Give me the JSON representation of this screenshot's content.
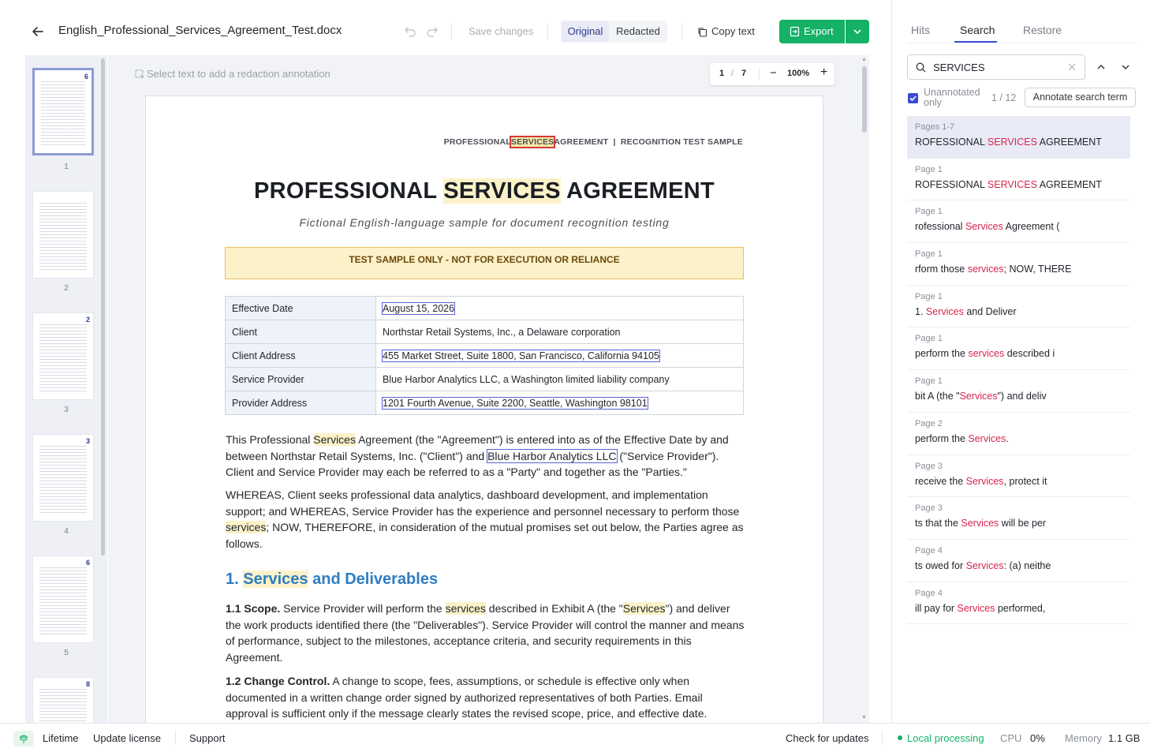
{
  "header": {
    "doc_title": "English_Professional_Services_Agreement_Test.docx",
    "save_label": "Save changes",
    "view_original": "Original",
    "view_redacted": "Redacted",
    "copy_label": "Copy text",
    "export_label": "Export"
  },
  "thumbnails": [
    {
      "badge": "6",
      "label": "1"
    },
    {
      "badge": "",
      "label": "2"
    },
    {
      "badge": "2",
      "label": "3"
    },
    {
      "badge": "3",
      "label": "4"
    },
    {
      "badge": "6",
      "label": "5"
    },
    {
      "badge": "8",
      "label": ""
    }
  ],
  "viewer": {
    "hint": "Select text to add a redaction annotation",
    "page_current": "1",
    "page_sep": "/",
    "page_total": "7",
    "zoom_minus": "−",
    "zoom": "100%",
    "zoom_plus": "+"
  },
  "document": {
    "running_head_pre": "PROFESSIONAL",
    "running_head_match": "SERVICES",
    "running_head_post": "AGREEMENT  |  RECOGNITION TEST SAMPLE",
    "title_pre": "PROFESSIONAL ",
    "title_match": "SERVICES",
    "title_post": " AGREEMENT",
    "subtitle": "Fictional English-language sample for document recognition testing",
    "banner": "TEST SAMPLE ONLY - NOT FOR EXECUTION OR RELIANCE",
    "table": [
      {
        "key": "Effective Date",
        "value": "August 15, 2026"
      },
      {
        "key": "Client",
        "value": "Northstar Retail Systems, Inc., a Delaware corporation"
      },
      {
        "key": "Client Address",
        "value": "455 Market Street, Suite 1800, San Francisco, California 94105"
      },
      {
        "key": "Service Provider",
        "value": "Blue Harbor Analytics LLC, a Washington limited liability company"
      },
      {
        "key": "Provider Address",
        "value": "1201 Fourth Avenue, Suite 2200, Seattle, Washington 98101"
      }
    ],
    "p1_a": "This Professional ",
    "p1_m": "Services",
    "p1_b": " Agreement (the \"Agreement\") is entered into as of the Effective Date by and between Northstar Retail Systems, Inc. (\"Client\") and ",
    "p1_box": "Blue Harbor Analytics LLC",
    "p1_c": " (\"Service Provider\"). Client and Service Provider may each be referred to as a \"Party\" and together as the \"Parties.\"",
    "p2_a": "WHEREAS, Client seeks professional data analytics, dashboard development, and implementation support; and WHEREAS, Service Provider has the experience and personnel necessary to perform those ",
    "p2_m": "services",
    "p2_b": "; NOW, THEREFORE, in consideration of the mutual promises set out below, the Parties agree as follows.",
    "sec1_num": "1. ",
    "sec1_match": "Services",
    "sec1_rest": " and Deliverables",
    "p3_bold": "1.1 Scope.",
    "p3_a": " Service Provider will perform the ",
    "p3_m1": "services",
    "p3_b": " described in Exhibit A (the \"",
    "p3_m2": "Services",
    "p3_c": "\") and deliver the work products identified there (the \"Deliverables\"). Service Provider will control the manner and means of performance, subject to the milestones, acceptance criteria, and security requirements in this Agreement.",
    "p4_bold": "1.2 Change Control.",
    "p4_a": " A change to scope, fees, assumptions, or schedule is effective only when documented in a written change order signed by authorized representatives of both Parties. Email approval is sufficient only if the message clearly states the revised scope, price, and effective date."
  },
  "panel": {
    "tabs": [
      "Hits",
      "Search",
      "Restore"
    ],
    "search_value": "SERVICES",
    "unannotated_label": "Unannotated only",
    "count": "1 / 12",
    "annotate_label": "Annotate search term",
    "hits": [
      {
        "page": "Pages 1-7",
        "pre": "ROFESSIONAL ",
        "match": "SERVICES",
        "post": " AGREEMENT"
      },
      {
        "page": "Page 1",
        "pre": "ROFESSIONAL ",
        "match": "SERVICES",
        "post": " AGREEMENT"
      },
      {
        "page": "Page 1",
        "pre": "rofessional ",
        "match": "Services",
        "post": " Agreement ("
      },
      {
        "page": "Page 1",
        "pre": "rform those ",
        "match": "services",
        "post": "; NOW, THERE"
      },
      {
        "page": "Page 1",
        "pre": "1. ",
        "match": "Services",
        "post": " and Deliver"
      },
      {
        "page": "Page 1",
        "pre": "perform the ",
        "match": "services",
        "post": " described i"
      },
      {
        "page": "Page 1",
        "pre": "bit A (the \"",
        "match": "Services",
        "post": "\") and deliv"
      },
      {
        "page": "Page 2",
        "pre": "perform the ",
        "match": "Services",
        "post": "."
      },
      {
        "page": "Page 3",
        "pre": "receive the ",
        "match": "Services",
        "post": ", protect it"
      },
      {
        "page": "Page 3",
        "pre": "ts that the ",
        "match": "Services",
        "post": " will be per"
      },
      {
        "page": "Page 4",
        "pre": "ts owed for ",
        "match": "Services",
        "post": ": (a) neithe"
      },
      {
        "page": "Page 4",
        "pre": "ill pay for ",
        "match": "Services",
        "post": " performed,"
      }
    ]
  },
  "footer": {
    "license": "Lifetime",
    "update_license": "Update license",
    "support": "Support",
    "check_updates": "Check for updates",
    "local": "Local processing",
    "cpu_label": "CPU",
    "cpu_value": "0%",
    "mem_label": "Memory",
    "mem_value": "1.1 GB"
  },
  "colors": {
    "accent": "#3a4cd1",
    "export": "#14b166",
    "match": "#d6264f",
    "highlight": "#fbf2c9"
  }
}
